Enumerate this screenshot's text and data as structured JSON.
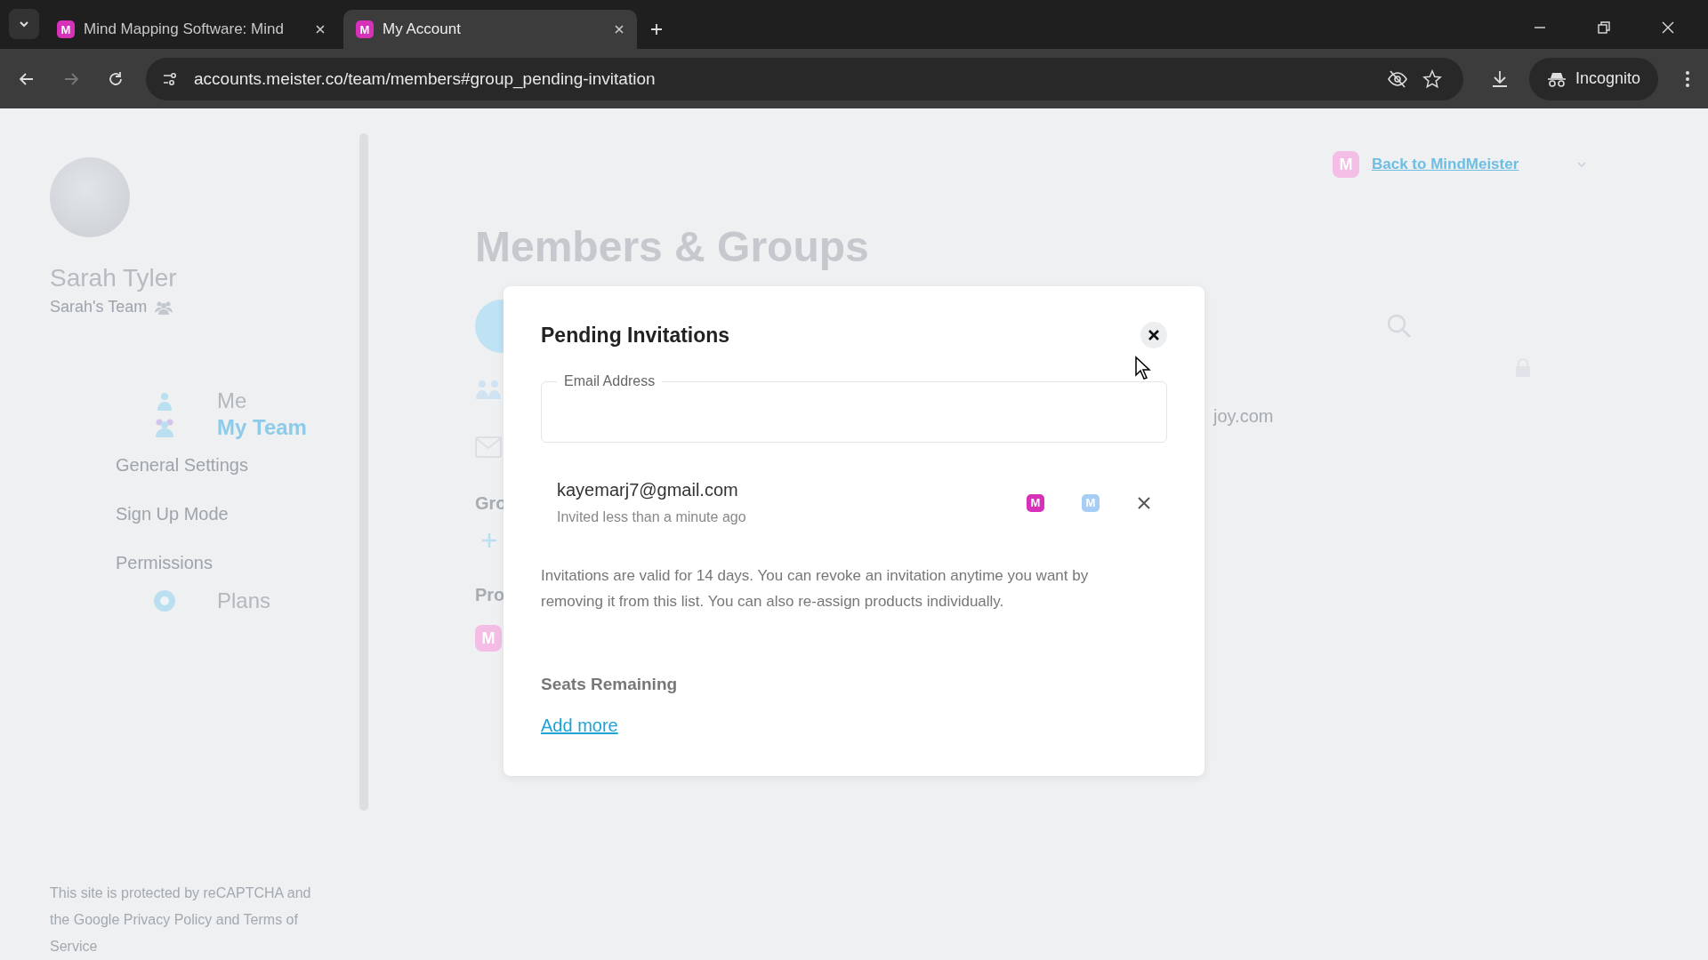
{
  "browser": {
    "tabs": [
      {
        "favicon": "M",
        "title": "Mind Mapping Software: Mind",
        "selected": false
      },
      {
        "favicon": "M",
        "title": "My Account",
        "selected": true
      }
    ],
    "url": "accounts.meister.co/team/members#group_pending-invitation",
    "profile": "Incognito"
  },
  "sidebar": {
    "user": {
      "name": "Sarah Tyler",
      "team": "Sarah's Team"
    },
    "nav": [
      {
        "label": "Me",
        "kind": "main",
        "selected": false
      },
      {
        "label": "My Team",
        "kind": "main",
        "selected": true
      },
      {
        "label": "General Settings",
        "kind": "sub",
        "selected": false
      },
      {
        "label": "Sign Up Mode",
        "kind": "sub",
        "selected": false
      },
      {
        "label": "Permissions",
        "kind": "sub",
        "selected": false
      },
      {
        "label": "Plans",
        "kind": "main",
        "selected": false
      }
    ],
    "notice": "This site is protected by reCAPTCHA and the Google Privacy Policy and Terms of Service"
  },
  "page": {
    "logo": "M",
    "product_logo": "M",
    "back_link": "Back to MindMeister",
    "title": "Members & Groups",
    "fragments": [
      "Gro",
      "Pro",
      "joy.com"
    ]
  },
  "modal": {
    "title": "Pending Invitations",
    "email_field": {
      "label": "Email Address"
    },
    "invitations": [
      {
        "email": "kayemarj7@gmail.com",
        "status": "Invited less than a minute ago",
        "products": [
          {
            "letter": "M",
            "active": true
          },
          {
            "letter": "M",
            "active": false
          }
        ]
      }
    ],
    "note": "Invitations are valid for 14 days. You can revoke an invitation anytime you want by removing it from this list. You can also re-assign products individually.",
    "seats_label": "Seats Remaining",
    "add_more": "Add more"
  }
}
